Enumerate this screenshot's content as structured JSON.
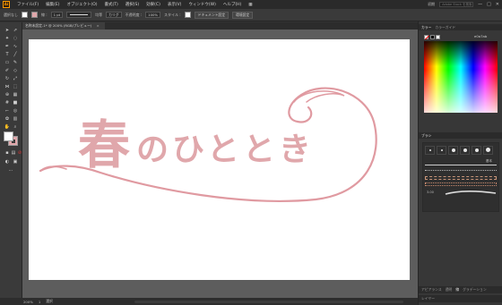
{
  "app": {
    "icon_label": "Ai"
  },
  "menubar": {
    "items": [
      "ファイル(F)",
      "編集(E)",
      "オブジェクト(O)",
      "書式(T)",
      "選択(S)",
      "効果(C)",
      "表示(V)",
      "ウィンドウ(W)",
      "ヘルプ(H)"
    ],
    "right_label": "初期",
    "search_placeholder": "Adobe Stock を検索",
    "minimize": "—",
    "maximize": "□",
    "close": "✕"
  },
  "controlbar": {
    "selection_label": "選択なし",
    "stroke_label": "線 :",
    "stroke_value": "1 pt",
    "stroke_style": "均等",
    "brush_label": "カリグ",
    "opacity_label": "不透明度 :",
    "opacity_value": "100%",
    "style_label": "スタイル :",
    "doc_setup": "ドキュメント設定",
    "prefs": "環境設定",
    "stroke_color": "#e0a7ab"
  },
  "document_tab": {
    "title": "名称未設定-1* @ 200% (RGB/プレビュー)",
    "close": "×"
  },
  "artwork": {
    "main_char": "春",
    "rest_chars": "のひととき",
    "text_color": "#e0a7ab",
    "swash_color": "#e09aa1"
  },
  "statusbar": {
    "zoom": "200%",
    "page": "1",
    "tool_name": "選択"
  },
  "panels": {
    "color": {
      "tabs": [
        "カラー",
        "カラーガイド"
      ],
      "hex": "e0a7ab"
    },
    "brushes": {
      "tabs": [
        "ブラシ"
      ],
      "basic_label": "基本",
      "size_label": "3.00"
    },
    "bottom": {
      "tabs": [
        "アピアランス",
        "透明",
        "線",
        "グラデーション"
      ],
      "layers": "レイヤー"
    }
  }
}
